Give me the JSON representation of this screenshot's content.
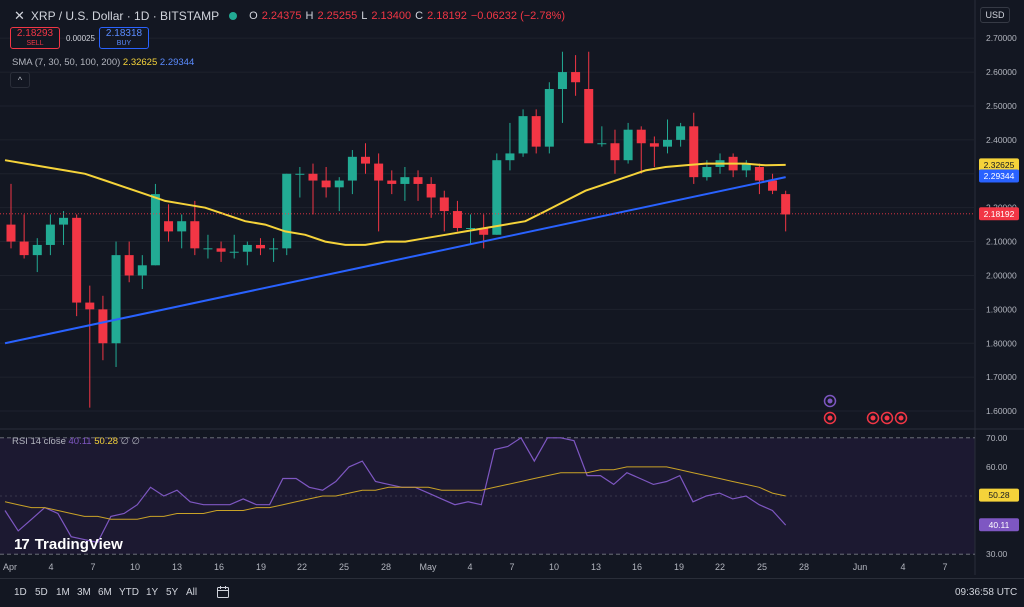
{
  "header": {
    "symbol": "XRP / U.S. Dollar · 1D · BITSTAMP",
    "ohlc": {
      "o_label": "O",
      "o": "2.24375",
      "h_label": "H",
      "h": "2.25255",
      "l_label": "L",
      "l": "2.13400",
      "c_label": "C",
      "c": "2.18192",
      "change": "−0.06232 (−2.78%)"
    }
  },
  "trade": {
    "sell_price": "2.18293",
    "sell_label": "SELL",
    "spread": "0.00025",
    "buy_price": "2.18318",
    "buy_label": "BUY"
  },
  "indicators": {
    "sma_label": "SMA (7, 30, 50, 100, 200)",
    "sma_val_1": "2.32625",
    "sma_val_2": "2.29344",
    "collapse": "^",
    "rsi_label": "RSI 14 close",
    "rsi_val": "40.11",
    "rsi_ma_val": "50.28",
    "rsi_flags": "∅ ∅"
  },
  "currency": "USD",
  "logo_text": "TradingView",
  "logo_mark": "17",
  "timeframes": [
    "1D",
    "5D",
    "1M",
    "3M",
    "6M",
    "YTD",
    "1Y",
    "5Y",
    "All"
  ],
  "clock": "09:36:58 UTC",
  "colors": {
    "up": "#22ab94",
    "down": "#f23645",
    "sma_yellow": "#f5d33a",
    "sma_blue": "#2962ff",
    "rsi": "#7e57c2",
    "bg": "#131722"
  },
  "chart_data": {
    "type": "candlestick",
    "price_axis": {
      "ticks": [
        "2.70000",
        "2.60000",
        "2.50000",
        "2.40000",
        "2.30000",
        "2.20000",
        "2.10000",
        "2.00000",
        "1.90000",
        "1.80000",
        "1.70000",
        "1.60000"
      ],
      "range": [
        1.55,
        2.73
      ]
    },
    "x_axis_labels": [
      "Apr",
      "4",
      "7",
      "10",
      "13",
      "16",
      "19",
      "22",
      "25",
      "28",
      "May",
      "4",
      "7",
      "10",
      "13",
      "16",
      "19",
      "22",
      "25",
      "28",
      "Jun",
      "4",
      "7"
    ],
    "candles": [
      [
        2.15,
        2.27,
        2.08,
        2.1
      ],
      [
        2.1,
        2.18,
        2.05,
        2.06
      ],
      [
        2.06,
        2.11,
        2.01,
        2.09
      ],
      [
        2.09,
        2.18,
        2.06,
        2.15
      ],
      [
        2.15,
        2.19,
        2.09,
        2.17
      ],
      [
        2.17,
        2.18,
        1.88,
        1.92
      ],
      [
        1.92,
        1.97,
        1.61,
        1.9
      ],
      [
        1.9,
        1.94,
        1.75,
        1.8
      ],
      [
        1.8,
        2.1,
        1.73,
        2.06
      ],
      [
        2.06,
        2.1,
        1.98,
        2.0
      ],
      [
        2.0,
        2.06,
        1.96,
        2.03
      ],
      [
        2.03,
        2.27,
        2.03,
        2.24
      ],
      [
        2.16,
        2.21,
        2.1,
        2.13
      ],
      [
        2.13,
        2.18,
        2.08,
        2.16
      ],
      [
        2.16,
        2.22,
        2.06,
        2.08
      ],
      [
        2.08,
        2.12,
        2.05,
        2.08
      ],
      [
        2.08,
        2.1,
        2.04,
        2.07
      ],
      [
        2.07,
        2.12,
        2.05,
        2.07
      ],
      [
        2.07,
        2.1,
        2.03,
        2.09
      ],
      [
        2.09,
        2.11,
        2.06,
        2.08
      ],
      [
        2.08,
        2.11,
        2.04,
        2.08
      ],
      [
        2.08,
        2.3,
        2.06,
        2.3
      ],
      [
        2.3,
        2.32,
        2.23,
        2.3
      ],
      [
        2.3,
        2.33,
        2.18,
        2.28
      ],
      [
        2.28,
        2.32,
        2.23,
        2.26
      ],
      [
        2.26,
        2.29,
        2.19,
        2.28
      ],
      [
        2.28,
        2.37,
        2.24,
        2.35
      ],
      [
        2.35,
        2.39,
        2.3,
        2.33
      ],
      [
        2.33,
        2.36,
        2.13,
        2.28
      ],
      [
        2.28,
        2.31,
        2.24,
        2.27
      ],
      [
        2.27,
        2.32,
        2.22,
        2.29
      ],
      [
        2.29,
        2.31,
        2.22,
        2.27
      ],
      [
        2.27,
        2.29,
        2.17,
        2.23
      ],
      [
        2.23,
        2.25,
        2.13,
        2.19
      ],
      [
        2.19,
        2.22,
        2.13,
        2.14
      ],
      [
        2.14,
        2.18,
        2.09,
        2.14
      ],
      [
        2.14,
        2.18,
        2.08,
        2.12
      ],
      [
        2.12,
        2.36,
        2.12,
        2.34
      ],
      [
        2.34,
        2.45,
        2.31,
        2.36
      ],
      [
        2.36,
        2.49,
        2.35,
        2.47
      ],
      [
        2.47,
        2.49,
        2.36,
        2.38
      ],
      [
        2.38,
        2.57,
        2.36,
        2.55
      ],
      [
        2.55,
        2.66,
        2.45,
        2.6
      ],
      [
        2.6,
        2.65,
        2.53,
        2.57
      ],
      [
        2.55,
        2.66,
        2.43,
        2.39
      ],
      [
        2.39,
        2.44,
        2.38,
        2.39
      ],
      [
        2.39,
        2.43,
        2.3,
        2.34
      ],
      [
        2.34,
        2.45,
        2.33,
        2.43
      ],
      [
        2.43,
        2.44,
        2.3,
        2.39
      ],
      [
        2.39,
        2.41,
        2.32,
        2.38
      ],
      [
        2.38,
        2.46,
        2.36,
        2.4
      ],
      [
        2.4,
        2.45,
        2.38,
        2.44
      ],
      [
        2.44,
        2.48,
        2.27,
        2.29
      ],
      [
        2.29,
        2.34,
        2.28,
        2.32
      ],
      [
        2.32,
        2.36,
        2.3,
        2.34
      ],
      [
        2.35,
        2.36,
        2.29,
        2.31
      ],
      [
        2.31,
        2.34,
        2.29,
        2.33
      ],
      [
        2.32,
        2.33,
        2.24,
        2.28
      ],
      [
        2.28,
        2.3,
        2.24,
        2.25
      ],
      [
        2.24,
        2.25,
        2.13,
        2.18
      ]
    ],
    "sma_yellow": [
      2.34,
      2.33,
      2.32,
      2.31,
      2.3,
      2.28,
      2.26,
      2.24,
      2.22,
      2.21,
      2.2,
      2.18,
      2.16,
      2.15,
      2.13,
      2.12,
      2.1,
      2.09,
      2.09,
      2.1,
      2.1,
      2.11,
      2.12,
      2.13,
      2.14,
      2.15,
      2.16,
      2.19,
      2.22,
      2.25,
      2.27,
      2.29,
      2.31,
      2.32,
      2.325,
      2.33,
      2.33,
      2.33,
      2.325,
      2.326
    ],
    "sma_blue": [
      1.8,
      2.29
    ],
    "last_price": "2.18192",
    "sma_price_1": "2.32625",
    "sma_price_2": "2.29344",
    "rsi_axis": {
      "ticks": [
        "70.00",
        "60.00",
        "50.00",
        "40.00",
        "30.00"
      ],
      "range": [
        28,
        72
      ]
    },
    "rsi_last_ma": "50.28",
    "rsi_last": "40.11",
    "rsi": [
      45,
      38,
      42,
      46,
      44,
      36,
      35,
      34,
      43,
      44,
      47,
      53,
      50,
      52,
      48,
      47,
      47,
      47,
      49,
      47,
      47,
      56,
      56,
      53,
      52,
      55,
      60,
      62,
      55,
      54,
      53,
      53,
      51,
      49,
      47,
      48,
      47,
      66,
      67,
      70,
      62,
      70,
      70,
      69,
      57,
      57,
      54,
      58,
      56,
      54,
      55,
      57,
      48,
      50,
      51,
      49,
      50,
      47,
      45,
      40
    ],
    "rsi_ma": [
      48,
      47,
      46,
      46,
      45,
      44,
      43,
      43,
      42,
      42,
      42,
      43,
      43,
      44,
      44,
      44,
      45,
      45,
      45,
      46,
      46,
      47,
      48,
      49,
      50,
      50,
      51,
      52,
      52,
      53,
      53,
      53,
      53,
      52,
      52,
      52,
      52,
      53,
      54,
      55,
      56,
      57,
      58,
      58,
      58,
      59,
      59,
      60,
      60,
      60,
      60,
      59,
      58,
      57,
      56,
      55,
      54,
      53,
      51,
      50
    ]
  }
}
